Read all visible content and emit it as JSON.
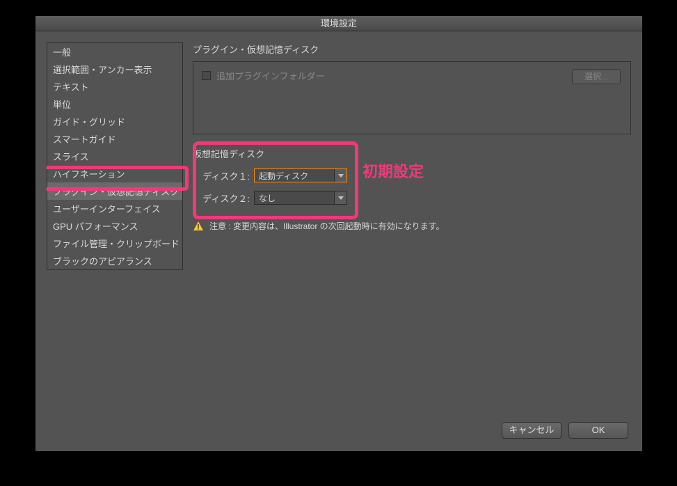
{
  "window": {
    "title": "環境設定"
  },
  "sidebar": {
    "items": [
      {
        "label": "一般"
      },
      {
        "label": "選択範囲・アンカー表示"
      },
      {
        "label": "テキスト"
      },
      {
        "label": "単位"
      },
      {
        "label": "ガイド・グリッド"
      },
      {
        "label": "スマートガイド"
      },
      {
        "label": "スライス"
      },
      {
        "label": "ハイフネーション"
      },
      {
        "label": "プラグイン・仮想記憶ディスク"
      },
      {
        "label": "ユーザーインターフェイス"
      },
      {
        "label": "GPU パフォーマンス"
      },
      {
        "label": "ファイル管理・クリップボード"
      },
      {
        "label": "ブラックのアピアランス"
      }
    ],
    "selectedIndex": 8
  },
  "content": {
    "heading": "プラグイン・仮想記憶ディスク",
    "pluginFolder": {
      "checkboxLabel": "追加プラグインフォルダー",
      "selectButton": "選択..."
    },
    "scratchDisk": {
      "title": "仮想記憶ディスク",
      "rows": [
        {
          "label": "ディスク１:",
          "value": "起動ディスク",
          "highlighted": true
        },
        {
          "label": "ディスク２:",
          "value": "なし",
          "highlighted": false
        }
      ]
    },
    "annotation": "初期設定",
    "notice": "注意 : 変更内容は、Illustrator の次回起動時に有効になります。"
  },
  "footer": {
    "cancel": "キャンセル",
    "ok": "OK"
  }
}
